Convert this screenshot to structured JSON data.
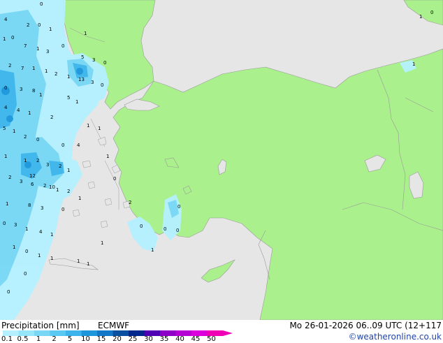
{
  "footer": {
    "title": "Precipitation [mm]",
    "model": "ECMWF",
    "validity": "Mo 26-01-2026 06..09 UTC (12+117",
    "credit": "©weatheronline.co.uk"
  },
  "legend": {
    "scale_labels": [
      "0.1",
      "0.5",
      "1",
      "2",
      "5",
      "10",
      "15",
      "20",
      "25",
      "30",
      "35",
      "40",
      "45",
      "50"
    ],
    "colors": [
      "#b4f0ff",
      "#96e6fa",
      "#78d7f5",
      "#5ac8f0",
      "#3cb4eb",
      "#1e96dc",
      "#1478c8",
      "#0a50a0",
      "#00288c",
      "#5000b4",
      "#8c00c8",
      "#b400d2",
      "#dc00dc",
      "#f000b4"
    ]
  },
  "map_colors": {
    "land": "#aaf08c",
    "sea": "#e6e6e6",
    "border": "#9a9a9a"
  },
  "rain_values": [
    "0",
    "4",
    "2",
    "0",
    "1",
    "1",
    "7",
    "1",
    "3",
    "0",
    "0",
    "1",
    "1",
    "5",
    "3",
    "0",
    "2",
    "7",
    "1",
    "2",
    "1",
    "0",
    "13",
    "3",
    "0",
    "3",
    "8",
    "1",
    "5",
    "1",
    "4",
    "4",
    "1",
    "2",
    "5",
    "1",
    "2",
    "0",
    "1",
    "1",
    "1",
    "1",
    "2",
    "3",
    "0",
    "4",
    "12",
    "2",
    "10",
    "1",
    "2",
    "3",
    "6",
    "2",
    "1",
    "2",
    "1",
    "1",
    "8",
    "3",
    "0",
    "0",
    "3",
    "1",
    "4",
    "1",
    "1",
    "0",
    "1",
    "1",
    "1",
    "1",
    "1",
    "0",
    "0",
    "1",
    "0",
    "2",
    "0",
    "1",
    "0",
    "0",
    "0",
    "1",
    "0",
    "1"
  ]
}
